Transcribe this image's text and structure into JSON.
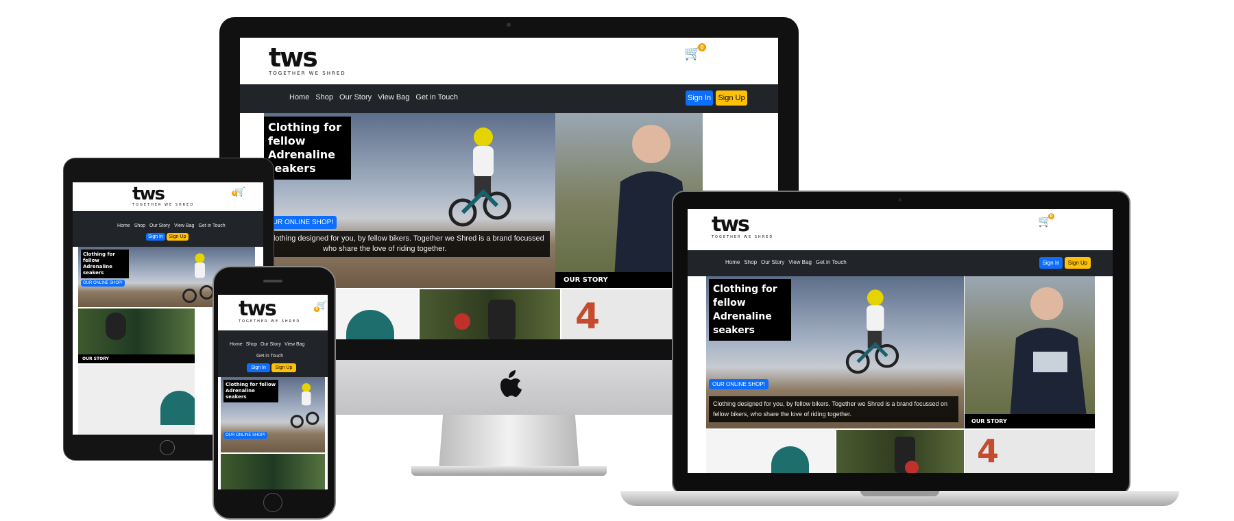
{
  "site": {
    "logo_mark": "tws",
    "logo_tagline": "TOGETHER WE SHRED",
    "cart_count": "0",
    "nav": [
      "Home",
      "Shop",
      "Our Story",
      "View Bag",
      "Get in Touch"
    ],
    "nav_phone": [
      "Home",
      "Shop",
      "Our Story",
      "View Bag"
    ],
    "nav_phone_extra": "Get in Touch",
    "sign_in": "Sign In",
    "sign_up": "Sign Up",
    "hero_title": "Clothing for fellow Adrenaline seakers",
    "shop_button": "OUR ONLINE SHOP!",
    "hero_description": "Clothing designed for you, by fellow bikers. Together we Shred is a brand focussed on fellow bikers, who share the love of riding together.",
    "imac_description_visible": "Clothing designed for you, by fellow bikers. Together we Shred is a brand focussed",
    "imac_description_line2": "who share the love of riding together.",
    "story_caption": "OUR STORY"
  },
  "colors": {
    "nav_bg": "#212529",
    "sign_in_bg": "#0d6efd",
    "sign_up_bg": "#ffc107",
    "cart_badge": "#f0a000"
  },
  "icons": [
    "cart-icon",
    "apple-logo-icon"
  ]
}
